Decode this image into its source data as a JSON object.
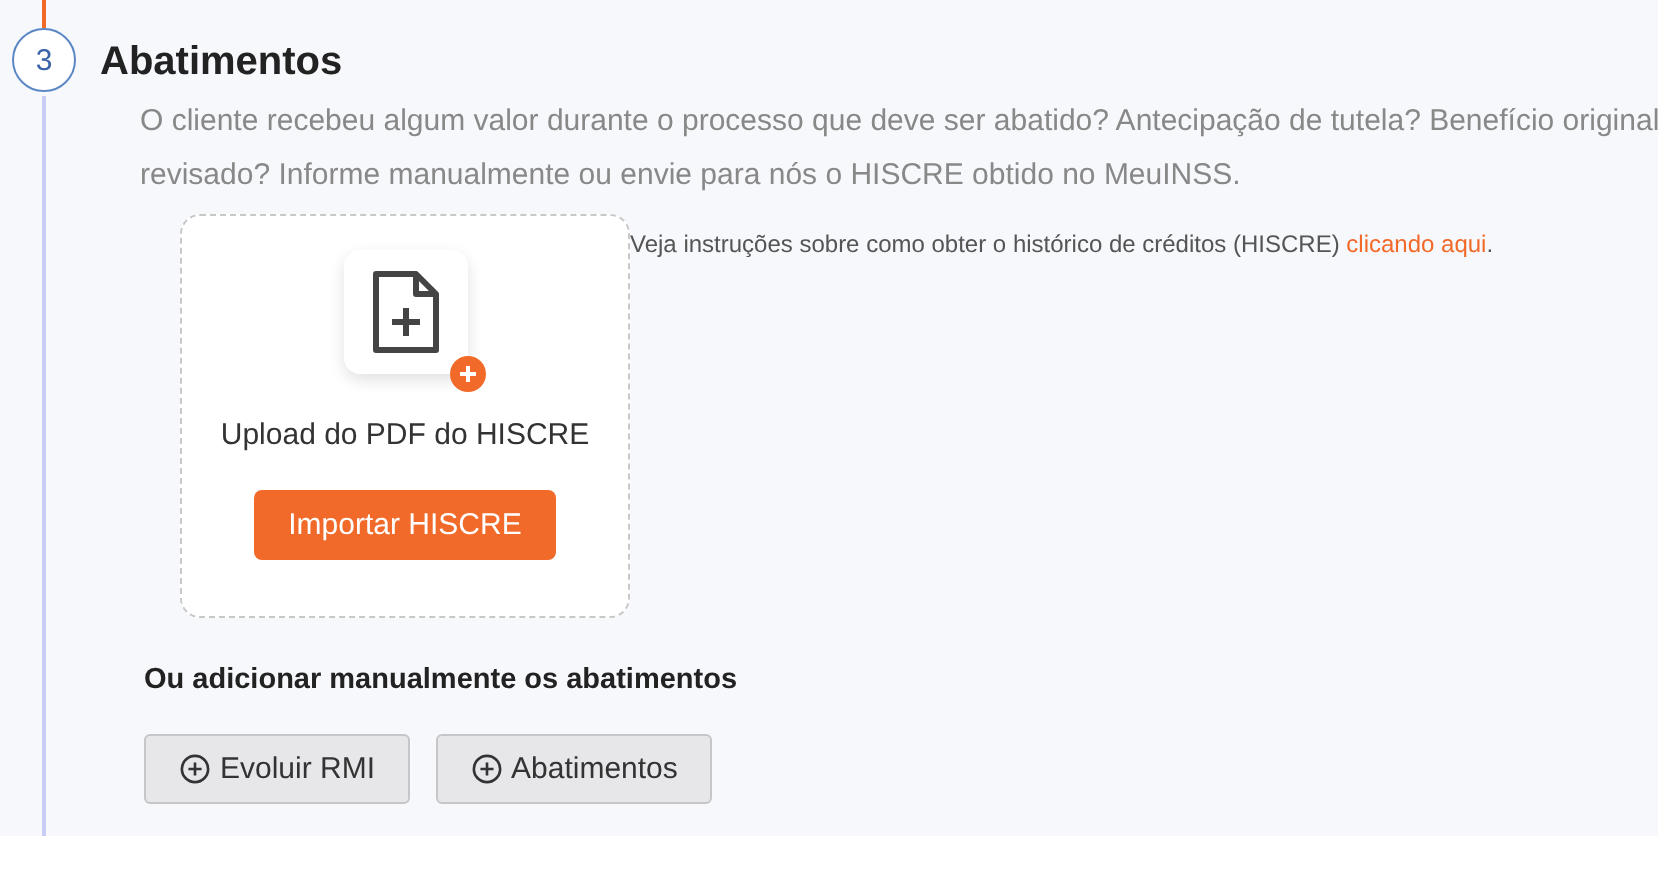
{
  "step": {
    "number": "3",
    "title": "Abatimentos",
    "description": "O cliente recebeu algum valor durante o processo que deve ser abatido? Antecipação de tutela? Benefício original revisado? Informe manualmente ou envie para nós o HISCRE obtido no MeuINSS."
  },
  "upload": {
    "label": "Upload do PDF do HISCRE",
    "button": "Importar HISCRE"
  },
  "instructions": {
    "text": "Veja instruções sobre como obter o histórico de créditos (HISCRE) ",
    "link": "clicando aqui",
    "end": "."
  },
  "manual": {
    "label": "Ou adicionar manualmente os abatimentos",
    "buttons": [
      "Evoluir RMI",
      "Abatimentos"
    ]
  }
}
